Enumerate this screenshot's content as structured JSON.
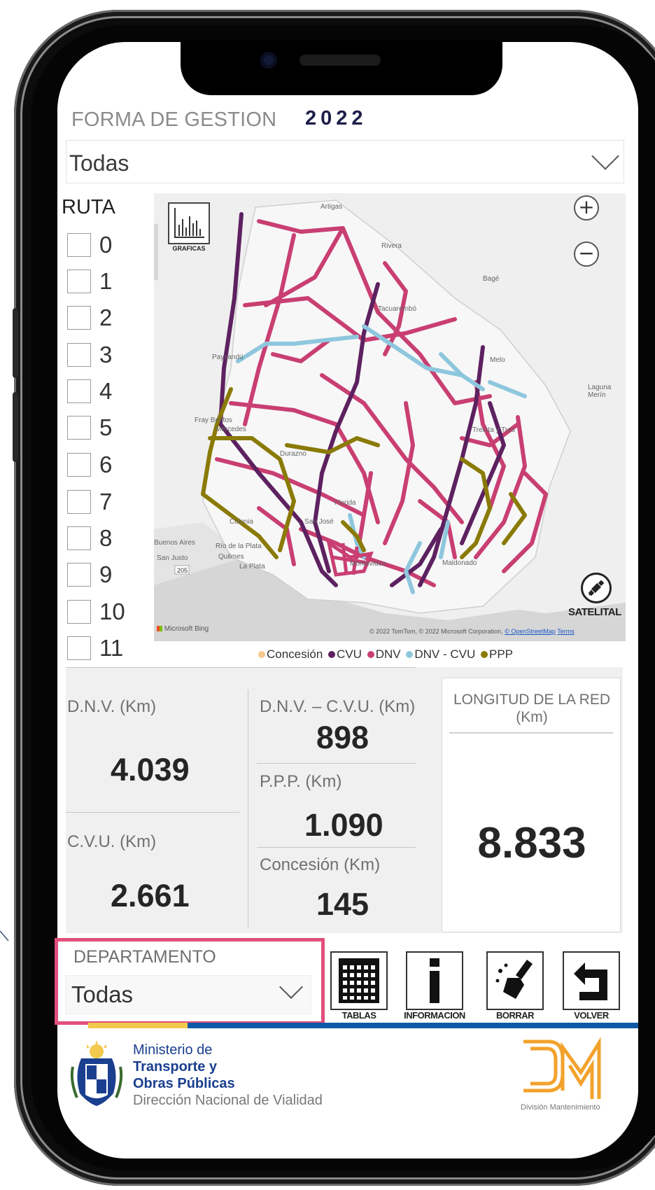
{
  "header": {
    "title": "FORMA DE GESTION",
    "year": "2022"
  },
  "forma_dropdown": {
    "value": "Todas"
  },
  "ruta": {
    "title": "RUTA",
    "items": [
      "0",
      "1",
      "2",
      "3",
      "4",
      "5",
      "6",
      "7",
      "8",
      "9",
      "10",
      "11"
    ]
  },
  "map": {
    "graficas_label": "GRAFICAS",
    "zoom_in": "+",
    "zoom_out": "−",
    "satelital_label": "SATELITAL",
    "bing_label": "Microsoft Bing",
    "place_labels": [
      "Artigas",
      "Rivera",
      "Bagé",
      "Tacuarembó",
      "Paysandú",
      "Melo",
      "Fray Bentos",
      "Mercedes",
      "Durazno",
      "Treinta y Tres",
      "Laguna Merín",
      "Florida",
      "San José",
      "Colonia",
      "Buenos Aires",
      "San Justo",
      "Río de la Plata",
      "Quilmes",
      "La Plata",
      "Montevideo",
      "Maldonado"
    ],
    "road_shield": "205",
    "copyright": "© 2022 TomTom, © 2022 Microsoft Corporation,",
    "copyright_link": "© OpenStreetMap",
    "terms": "Terms"
  },
  "legend": [
    {
      "label": "Concesión",
      "color": "#f5c98a"
    },
    {
      "label": "CVU",
      "color": "#5d2160"
    },
    {
      "label": "DNV",
      "color": "#c93f72"
    },
    {
      "label": "DNV - CVU",
      "color": "#8ec7dd"
    },
    {
      "label": "PPP",
      "color": "#8a7a06"
    }
  ],
  "stats": {
    "dnv": {
      "label": "D.N.V. (Km)",
      "value": "4.039"
    },
    "cvu": {
      "label": "C.V.U. (Km)",
      "value": "2.661"
    },
    "dnv_cvu": {
      "label": "D.N.V. – C.V.U. (Km)",
      "value": "898"
    },
    "ppp": {
      "label": "P.P.P. (Km)",
      "value": "1.090"
    },
    "concesion": {
      "label": "Concesión (Km)",
      "value": "145"
    },
    "total": {
      "label_line1": "LONGITUD DE LA RED",
      "label_line2": "(Km)",
      "value": "8.833"
    }
  },
  "departamento": {
    "label": "DEPARTAMENTO",
    "value": "Todas"
  },
  "actions": {
    "tablas": "TABLAS",
    "informacion": "INFORMACION",
    "borrar": "BORRAR",
    "volver": "VOLVER"
  },
  "footer": {
    "line1": "Ministerio de",
    "line2": "Transporte y",
    "line3": "Obras Públicas",
    "line4": "Dirección Nacional de Vialidad",
    "division": "División Mantenimiento"
  },
  "colors": {
    "accent_pink": "#e24f7c",
    "footer_blue": "#0f5aa8",
    "footer_yellow": "#f2c94c",
    "logo_orange": "#f2a22c"
  }
}
